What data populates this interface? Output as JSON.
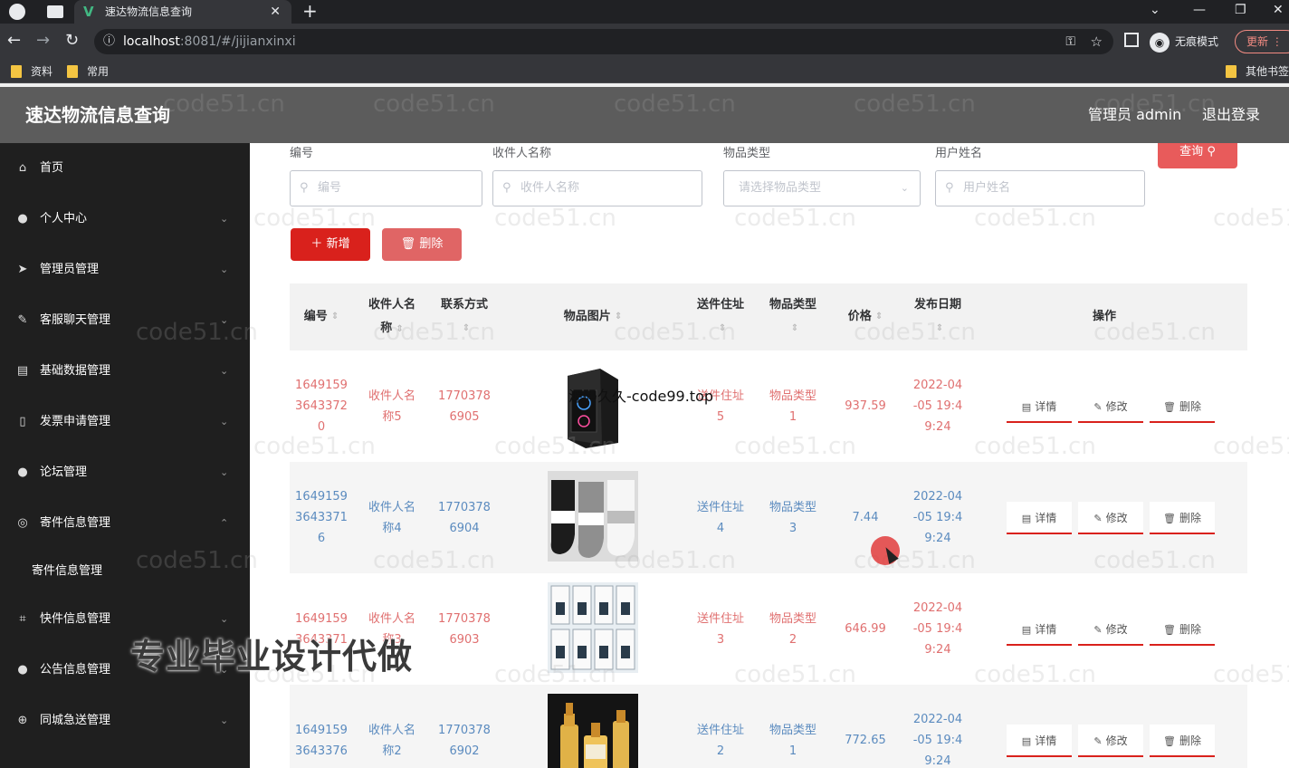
{
  "browser": {
    "tab_title": "速达物流信息查询",
    "tab_close": "✕",
    "new_tab": "+",
    "url_host": "localhost",
    "url_path": ":8081/#/jijianxinxi",
    "incognito_label": "无痕模式",
    "update_label": "更新",
    "bookmarks": [
      "资料",
      "常用"
    ],
    "other_bookmarks": "其他书签"
  },
  "header": {
    "title": "速达物流信息查询",
    "user": "管理员 admin",
    "logout": "退出登录"
  },
  "sidebar": {
    "items": [
      {
        "label": "首页",
        "icon": "home-icon"
      },
      {
        "label": "个人中心",
        "icon": "user-icon"
      },
      {
        "label": "管理员管理",
        "icon": "send-icon"
      },
      {
        "label": "客服聊天管理",
        "icon": "edit-icon"
      },
      {
        "label": "基础数据管理",
        "icon": "inbox-icon"
      },
      {
        "label": "发票申请管理",
        "icon": "phone-icon"
      },
      {
        "label": "论坛管理",
        "icon": "user-icon"
      },
      {
        "label": "寄件信息管理",
        "icon": "target-icon"
      },
      {
        "label": "快件信息管理",
        "icon": "crop-icon"
      },
      {
        "label": "公告信息管理",
        "icon": "bulb-icon"
      },
      {
        "label": "同城急送管理",
        "icon": "globe-icon"
      }
    ],
    "sub_item": "寄件信息管理"
  },
  "filters": {
    "bianhao_label": "编号",
    "bianhao_placeholder": "编号",
    "shoujianren_label": "收件人名称",
    "shoujianren_placeholder": "收件人名称",
    "wupin_label": "物品类型",
    "wupin_placeholder": "请选择物品类型",
    "yonghu_label": "用户姓名",
    "yonghu_placeholder": "用户姓名",
    "query_label": "查询"
  },
  "actions": {
    "add_label": "新增",
    "delete_label": "删除"
  },
  "table": {
    "headers": {
      "bianhao": "编号",
      "shoujianren_1": "收件人名",
      "shoujianren_2": "称",
      "lianxi": "联系方式",
      "tupian": "物品图片",
      "dizhi": "送件住址",
      "leixing": "物品类型",
      "jiage": "价格",
      "riqi": "发布日期",
      "caozuo": "操作"
    },
    "rows": [
      {
        "id": [
          "1649159",
          "3643372",
          "0"
        ],
        "name": [
          "收件人名",
          "称5"
        ],
        "phone": [
          "1770378",
          "6905"
        ],
        "addr": [
          "送件住址",
          "5"
        ],
        "type": [
          "物品类型",
          "1"
        ],
        "price": "937.59",
        "date": [
          "2022-04",
          "-05 19:4",
          "9:24"
        ],
        "image": "pc-case-image",
        "color": "red"
      },
      {
        "id": [
          "1649159",
          "3643371",
          "6"
        ],
        "name": [
          "收件人名",
          "称4"
        ],
        "phone": [
          "1770378",
          "6904"
        ],
        "addr": [
          "送件住址",
          "4"
        ],
        "type": [
          "物品类型",
          "3"
        ],
        "price": "7.44",
        "date": [
          "2022-04",
          "-05 19:4",
          "9:24"
        ],
        "image": "socks-image",
        "color": "blue"
      },
      {
        "id": [
          "1649159",
          "3643371"
        ],
        "name": [
          "收件人名",
          "称3"
        ],
        "phone": [
          "1770378",
          "6903"
        ],
        "addr": [
          "送件住址",
          "3"
        ],
        "type": [
          "物品类型",
          "2"
        ],
        "price": "646.99",
        "date": [
          "2022-04",
          "-05 19:4",
          "9:24"
        ],
        "image": "tea-boxes-image",
        "color": "red"
      },
      {
        "id": [
          "1649159",
          "3643376"
        ],
        "name": [
          "收件人名",
          "称2"
        ],
        "phone": [
          "1770378",
          "6902"
        ],
        "addr": [
          "送件住址",
          "2"
        ],
        "type": [
          "物品类型",
          "1"
        ],
        "price": "772.65",
        "date": [
          "2022-04",
          "-05 19:4",
          "9:24"
        ],
        "image": "serum-bottles-image",
        "color": "blue"
      }
    ],
    "op_detail": "详情",
    "op_edit": "修改",
    "op_delete": "删除"
  },
  "overlays": {
    "watermark": "code51.cn",
    "image_caption": "源码久久-code99.top",
    "banner": "专业毕业设计代做"
  }
}
